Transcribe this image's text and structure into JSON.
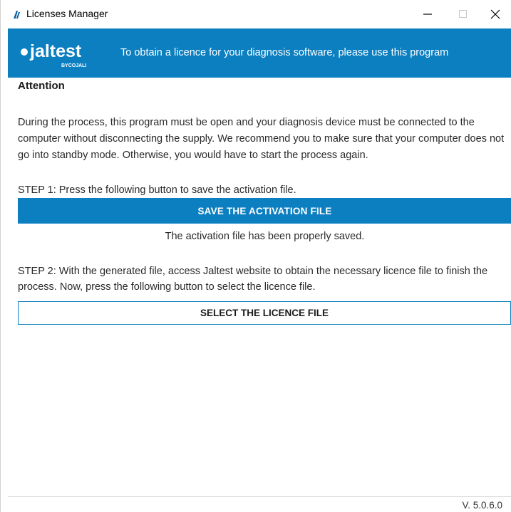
{
  "window": {
    "title": "Licenses Manager",
    "icons": [
      "app-icon",
      "minimize-icon",
      "maximize-icon",
      "close-icon"
    ]
  },
  "header": {
    "brand": "jaltest",
    "brand_sub": "BYCOJALI",
    "text": "To obtain a licence for your diagnosis software, please use this program",
    "color": "#0b7fc0"
  },
  "main": {
    "attention": "Attention",
    "intro": "During the process, this program must be open and your diagnosis device must be connected to the computer without disconnecting the supply. We recommend you to make sure that your computer does not go into standby mode. Otherwise, you would have to start the process again.",
    "step1": "STEP 1: Press the following button to save the activation file.",
    "save_button": "SAVE THE ACTIVATION FILE",
    "saved_message": "The activation file has been properly saved.",
    "step2": "STEP 2: With the generated file, access Jaltest website to obtain the necessary licence file to finish the process. Now, press the following button to select the licence file.",
    "select_button": "SELECT THE LICENCE FILE"
  },
  "footer": {
    "version": "V. 5.0.6.0"
  }
}
